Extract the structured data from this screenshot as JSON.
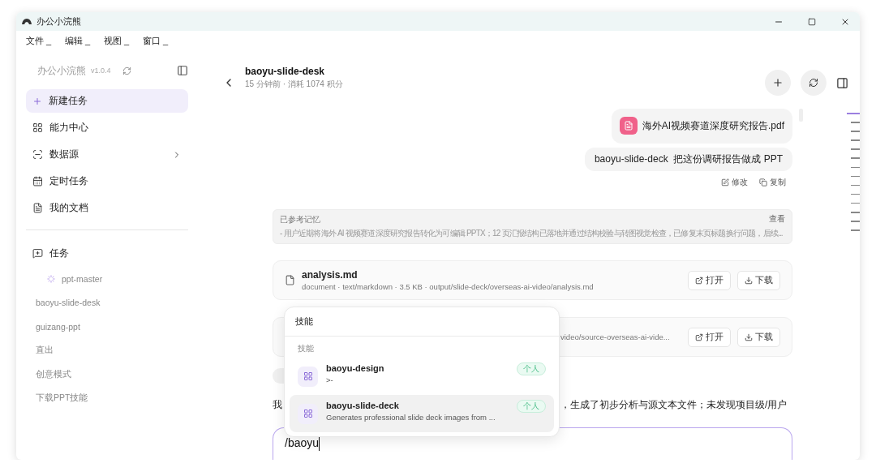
{
  "window": {
    "title": "办公小浣熊"
  },
  "menu": [
    {
      "label": "文件 _"
    },
    {
      "label": "编辑 _"
    },
    {
      "label": "视图 _"
    },
    {
      "label": "窗口 _"
    }
  ],
  "sidebar": {
    "app_name": "办公小浣熊",
    "version": "v1.0.4",
    "new_task": "新建任务",
    "nav": [
      {
        "label": "能力中心",
        "kind": "apps",
        "has_submenu": false
      },
      {
        "label": "数据源",
        "kind": "source",
        "has_submenu": true
      },
      {
        "label": "定时任务",
        "kind": "calendar",
        "has_submenu": false
      },
      {
        "label": "我的文档",
        "kind": "doc",
        "has_submenu": false
      }
    ],
    "tasks_heading": "任务",
    "tasks": [
      {
        "label": "ppt-master",
        "running": true
      },
      {
        "label": "baoyu-slide-desk",
        "running": false
      },
      {
        "label": "guizang-ppt",
        "running": false
      },
      {
        "label": "直出",
        "running": false
      },
      {
        "label": "创意模式",
        "running": false
      },
      {
        "label": "下载PPT技能",
        "running": false
      }
    ]
  },
  "header": {
    "title": "baoyu-slide-desk",
    "subtitle": "15 分钟前 · 消耗 1074 积分"
  },
  "attachment": {
    "name": "海外AI视频赛道深度研究报告.pdf"
  },
  "user_message": {
    "text": "baoyu-slide-deck  把这份调研报告做成 PPT",
    "actions": [
      {
        "label": "修改",
        "kind": "edit"
      },
      {
        "label": "复制",
        "kind": "copy"
      }
    ]
  },
  "memory": {
    "title": "已参考记忆",
    "action": "查看",
    "text": "- 用户近期将海外 AI 视频赛道深度研究报告转化为可编辑 PPTX；12 页汇报结构已落地并通过结构校验与转图视觉检查，已修复末页标题换行问题，后续..."
  },
  "files": [
    {
      "name": "analysis.md",
      "meta": "document · text/markdown · 3.5 KB · output/slide-deck/overseas-ai-video/analysis.md",
      "buttons": [
        {
          "label": "打开",
          "kind": "open"
        },
        {
          "label": "下载",
          "kind": "download"
        }
      ]
    },
    {
      "meta": "video/source-overseas-ai-vide...",
      "buttons": [
        {
          "label": "打开",
          "kind": "open"
        },
        {
          "label": "下载",
          "kind": "download"
        }
      ]
    }
  ],
  "reply": {
    "start": "我",
    "end": "，生成了初步分析与源文本文件；未发现项目级/用户"
  },
  "input": {
    "value": "/baoyu"
  },
  "popup": {
    "title": "技能",
    "section": "技能",
    "items": [
      {
        "name": "baoyu-design",
        "description": ">-",
        "tag": "个人",
        "selected": false
      },
      {
        "name": "baoyu-slide-deck",
        "description": "Generates professional slide deck images from ...",
        "tag": "个人",
        "selected": true
      }
    ]
  },
  "timeline": [
    {
      "active": true
    },
    {
      "active": false
    },
    {
      "active": false
    },
    {
      "active": false
    },
    {
      "active": false
    },
    {
      "active": false
    },
    {
      "active": false
    },
    {
      "active": false
    },
    {
      "active": false
    },
    {
      "active": false
    },
    {
      "active": false
    },
    {
      "active": false
    },
    {
      "active": false
    },
    {
      "active": false
    }
  ]
}
